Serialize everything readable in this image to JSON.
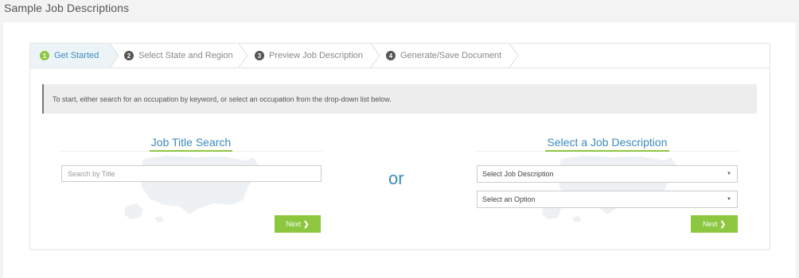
{
  "page": {
    "title": "Sample Job Descriptions"
  },
  "wizard": {
    "steps": [
      {
        "number": "1",
        "label": "Get Started",
        "active": true
      },
      {
        "number": "2",
        "label": "Select State and Region",
        "active": false
      },
      {
        "number": "3",
        "label": "Preview Job Description",
        "active": false
      },
      {
        "number": "4",
        "label": "Generate/Save Document",
        "active": false
      }
    ]
  },
  "instruction": "To start, either search for an occupation by keyword, or select an occupation from the drop-down list below.",
  "left": {
    "title": "Job Title Search",
    "search_placeholder": "Search by Title",
    "search_value": "",
    "next_label": "Next",
    "next_icon": "chevron-right-icon"
  },
  "divider_text": "or",
  "right": {
    "title": "Select a Job Description",
    "job_select_value": "Select Job Description",
    "option_select_value": "Select an Option",
    "next_label": "Next",
    "next_icon": "chevron-right-icon"
  },
  "colors": {
    "accent_blue": "#3b8bbd",
    "accent_green": "#8dc63f",
    "page_bg": "#f3f3f4"
  }
}
